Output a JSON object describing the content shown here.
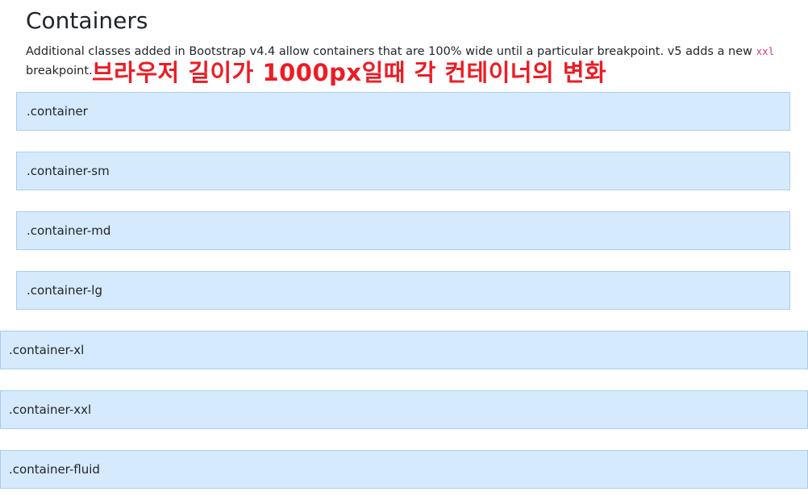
{
  "page": {
    "title": "Containers",
    "lead_text": "Additional classes added in Bootstrap v4.4 allow containers that are 100% wide until a particular breakpoint. v5 adds a new ",
    "lead_code": "xxl",
    "lead_text_end": " breakpoint.",
    "annotation": "브라우저 길이가 1000px일때 각 컨테이너의 변화"
  },
  "containers": [
    {
      "label": ".container"
    },
    {
      "label": ".container-sm"
    },
    {
      "label": ".container-md"
    },
    {
      "label": ".container-lg"
    },
    {
      "label": ".container-xl"
    },
    {
      "label": ".container-xxl"
    },
    {
      "label": ".container-fluid"
    }
  ],
  "colors": {
    "box_bg": "#d6eafd",
    "box_border": "#a8cdf0",
    "annotation": "#ed1c24",
    "code": "#d63384"
  }
}
